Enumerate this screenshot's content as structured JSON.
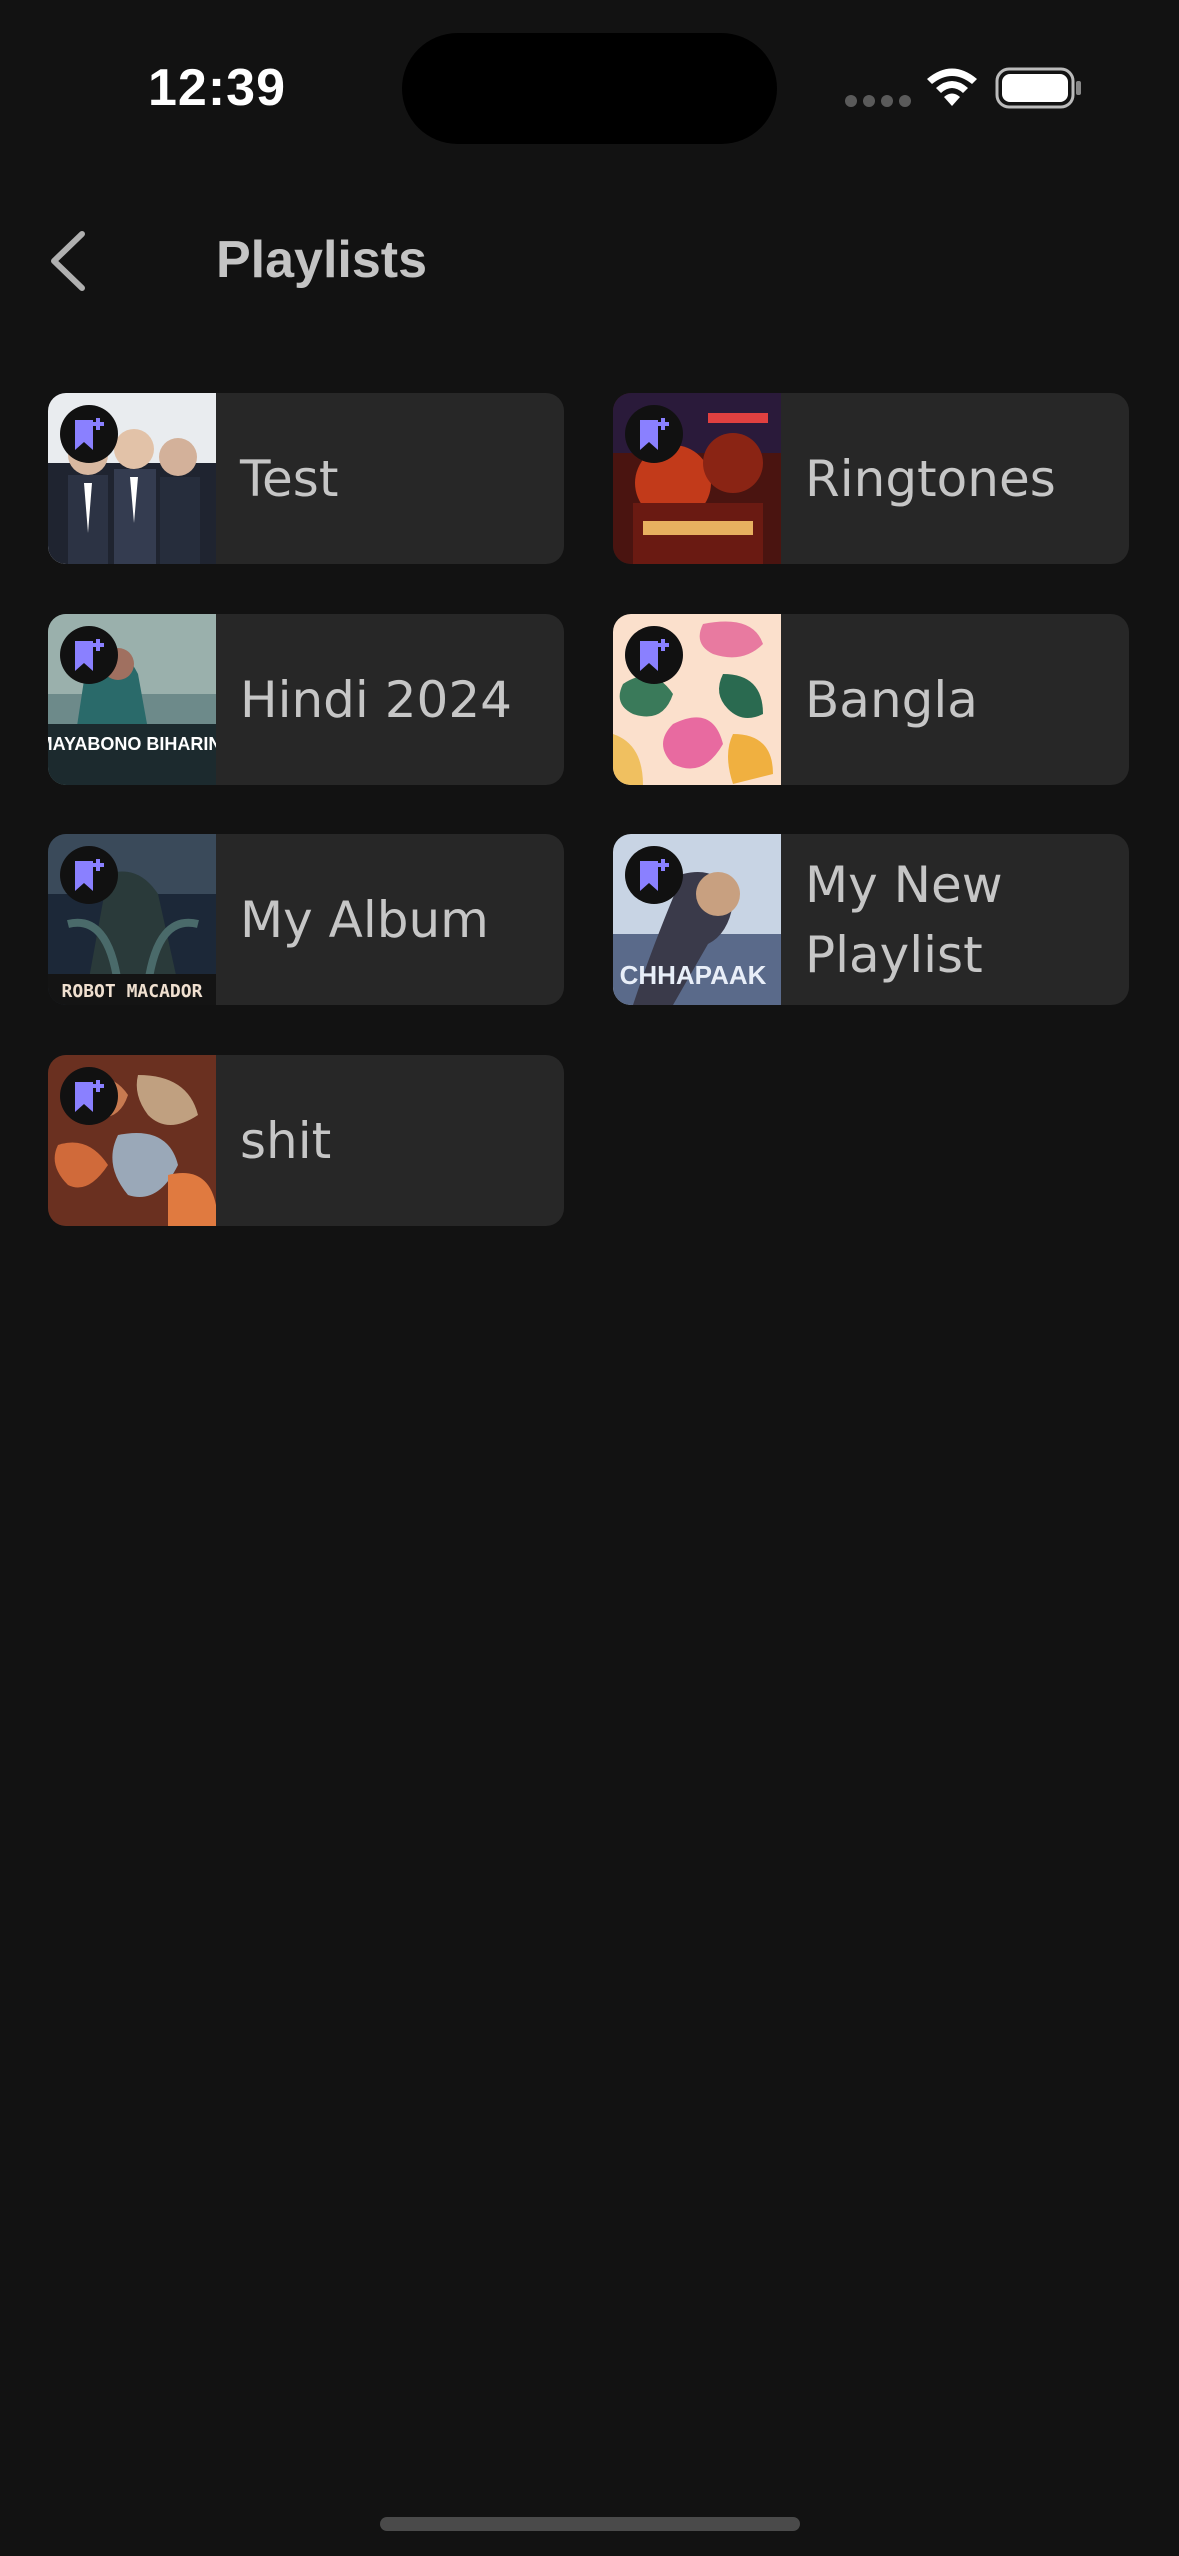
{
  "status_bar": {
    "time": "12:39"
  },
  "header": {
    "title": "Playlists",
    "back_icon": "chevron-left-icon"
  },
  "colors": {
    "background": "#121212",
    "card": "#272727",
    "badge_icon": "#8a80ff"
  },
  "playlists": [
    {
      "name": "Test"
    },
    {
      "name": "Ringtones"
    },
    {
      "name": "Hindi 2024"
    },
    {
      "name": "Bangla"
    },
    {
      "name": "My Album"
    },
    {
      "name": "My New Playlist"
    },
    {
      "name": "shit"
    }
  ],
  "cover_texts": {
    "hindi_2024": "MAYABONO BIHARINI",
    "my_album": "ROBOT MACADOR",
    "my_new_playlist": "CHHAPAAK"
  }
}
